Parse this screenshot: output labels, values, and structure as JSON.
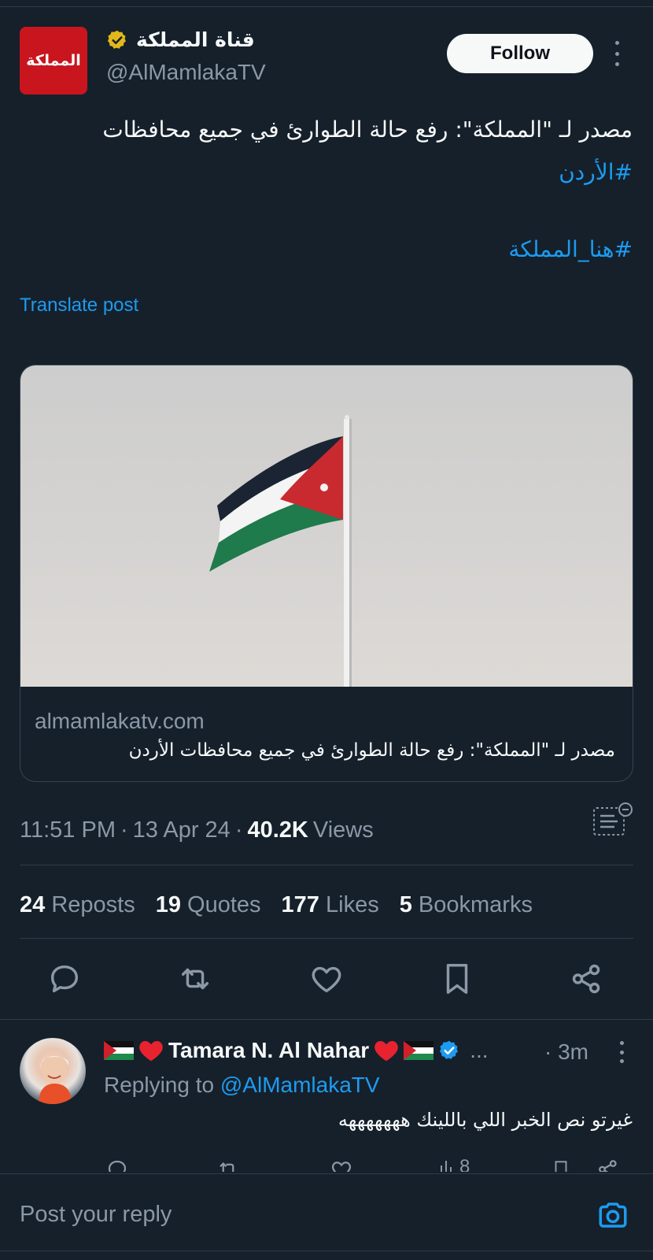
{
  "post": {
    "author_name": "قناة المملكة",
    "author_handle": "@AlMamlakaTV",
    "logo_text": "المملكة",
    "follow_label": "Follow",
    "text_line1": "مصدر لـ \"المملكة\": رفع حالة الطوارئ في جميع محافظات",
    "hashtag1": "#الأردن",
    "hashtag2": "#هنا_المملكة",
    "translate_label": "Translate post",
    "card": {
      "domain": "almamlakatv.com",
      "title": "مصدر لـ \"المملكة\": رفع حالة الطوارئ في جميع محافظات الأردن"
    },
    "time": "11:51 PM",
    "date": "13 Apr 24",
    "views_count": "40.2K",
    "views_label": "Views"
  },
  "stats": {
    "reposts_count": "24",
    "reposts_label": "Reposts",
    "quotes_count": "19",
    "quotes_label": "Quotes",
    "likes_count": "177",
    "likes_label": "Likes",
    "bookmarks_count": "5",
    "bookmarks_label": "Bookmarks"
  },
  "reply": {
    "name": "Tamara N. Al Nahar",
    "ellipsis": "...",
    "time": "3m",
    "replying_prefix": "Replying to",
    "replying_handle": "@AlMamlakaTV",
    "text": "غيرتو نص الخبر اللي باللينك هههههههه",
    "views": "8"
  },
  "compose": {
    "placeholder": "Post your reply"
  },
  "colors": {
    "background": "#15202b",
    "accent": "#1d9bf0",
    "secondary_text": "#8b98a5",
    "logo_red": "#c9151e",
    "verified_gold": "#e2b719"
  },
  "icons": [
    "verified-gold-icon",
    "more-icon",
    "analytics-icon",
    "reply-icon",
    "repost-icon",
    "like-icon",
    "bookmark-icon",
    "share-icon",
    "verified-blue-icon",
    "heart-emoji",
    "jordan-flag-emoji",
    "views-icon",
    "camera-icon"
  ]
}
